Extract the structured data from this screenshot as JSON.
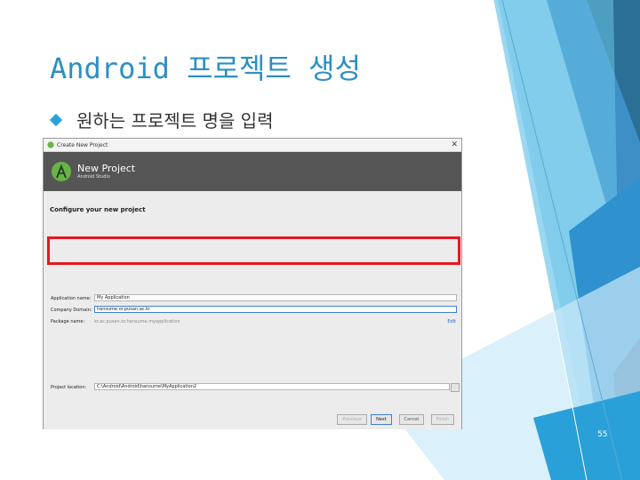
{
  "slide": {
    "title": "Android 프로젝트 생성",
    "bullet": "원하는 프로젝트 명을 입력",
    "page_number": "55"
  },
  "dialog": {
    "window_title": "Create New Project",
    "header_title": "New Project",
    "header_subtitle": "Android Studio",
    "section_title": "Configure your new project",
    "fields": {
      "application_name": {
        "label": "Application name:",
        "value": "My Application"
      },
      "company_domain": {
        "label": "Company Domain:",
        "value": "hansume.or.pusan.ac.kr"
      },
      "package_name": {
        "label": "Package name:",
        "value": "kr.ac.pusan.or.hansume.myapplication",
        "edit_label": "Edit"
      },
      "project_location": {
        "label": "Project location:",
        "value": "C:\\Android\\Android\\hansume\\MyApplication2"
      }
    },
    "buttons": {
      "previous": "Previous",
      "next": "Next",
      "cancel": "Cancel",
      "finish": "Finish"
    }
  },
  "colors": {
    "title": "#2b8fc4",
    "highlight": "#e8171f",
    "banner": "#555555",
    "accent_dark": "#2a6f95",
    "accent_light": "#7dcdeb"
  }
}
